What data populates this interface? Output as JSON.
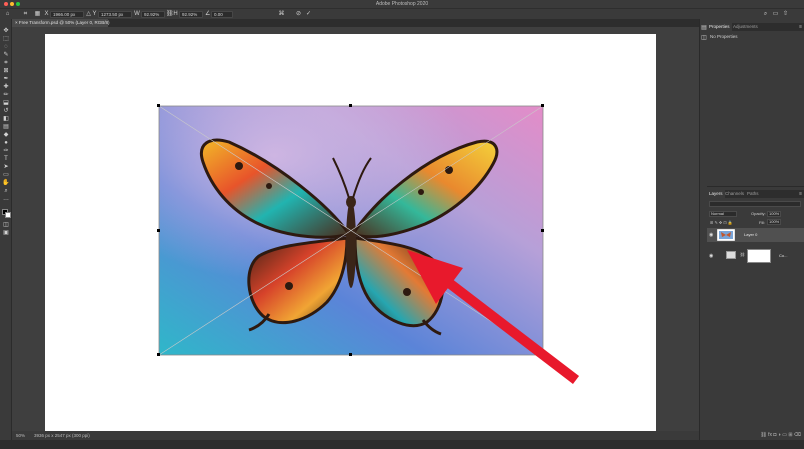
{
  "window": {
    "title": "Adobe Photoshop 2020"
  },
  "options_bar": {
    "x_value": "1966.00 px",
    "y_value": "1273.50 px",
    "w_value": "92.92%",
    "h_value": "92.92%",
    "angle_value": "0.00"
  },
  "document": {
    "tab_title": "Free Transform.psd @ 50% (Layer 0, RGB/8)"
  },
  "status": {
    "zoom": "50%",
    "doc_info": "3936 px x 2547 px (300 ppi)"
  },
  "properties_panel": {
    "tabs": [
      "Properties",
      "Adjustments"
    ],
    "empty_text": "No Properties"
  },
  "layers_panel": {
    "tabs": [
      "Layers",
      "Channels",
      "Paths"
    ],
    "blend_mode": "Normal",
    "opacity_label": "Opacity:",
    "opacity_value": "100%",
    "fill_label": "Fill:",
    "fill_value": "100%",
    "layers": [
      {
        "name": "Layer 0",
        "selected": true
      },
      {
        "name": "Co...",
        "selected": false
      }
    ]
  },
  "colors": {
    "accent_arrow": "#e8192c",
    "panel_bg": "#3a3a3a",
    "canvas_bg": "#3f3f3f"
  }
}
